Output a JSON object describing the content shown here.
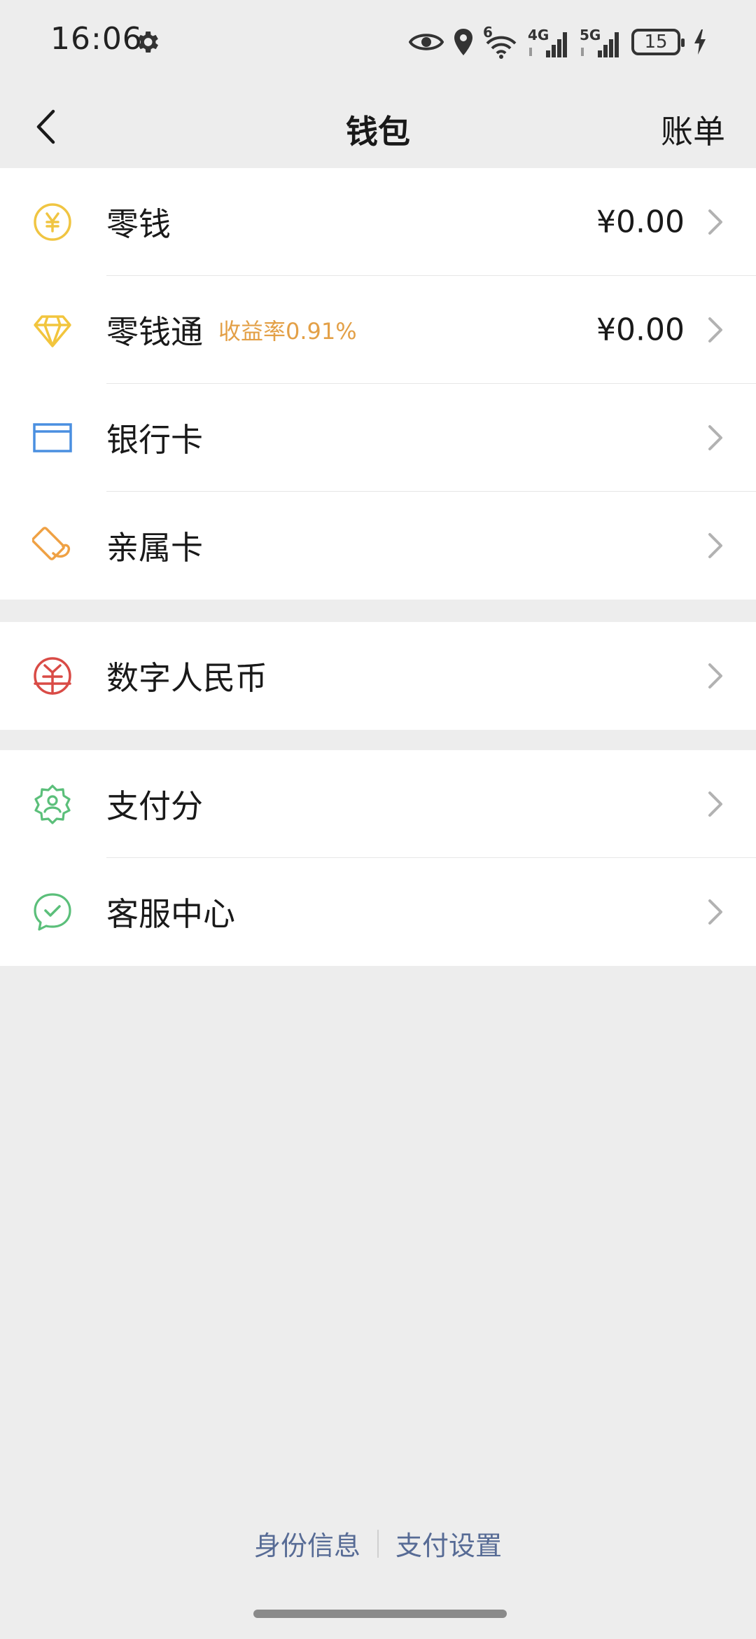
{
  "status_bar": {
    "time": "16:06",
    "gear_icon": "gear-icon",
    "eye_icon": "eye-icon",
    "location_icon": "location-pin-icon",
    "wifi_label": "6",
    "network_1_label": "4G",
    "network_2_label": "5G",
    "battery_level": "15",
    "charging_icon": "lightning-bolt-icon"
  },
  "header": {
    "title": "钱包",
    "back_icon": "chevron-left-icon",
    "bill_label": "账单"
  },
  "groups": [
    {
      "items": [
        {
          "label": "零钱",
          "value": "¥0.00",
          "icon": "yuan-coin-icon",
          "icon_color": "#f0c542"
        },
        {
          "label": "零钱通",
          "badge": "收益率0.91%",
          "value": "¥0.00",
          "icon": "diamond-icon",
          "icon_color": "#f2c53d"
        },
        {
          "label": "银行卡",
          "icon": "bank-card-icon",
          "icon_color": "#4a8fe0"
        },
        {
          "label": "亲属卡",
          "icon": "family-card-icon",
          "icon_color": "#efa144"
        }
      ]
    },
    {
      "items": [
        {
          "label": "数字人民币",
          "icon": "digital-rmb-icon",
          "icon_color": "#d94b46"
        }
      ]
    },
    {
      "items": [
        {
          "label": "支付分",
          "icon": "pay-score-badge-icon",
          "icon_color": "#5bbf7a"
        },
        {
          "label": "客服中心",
          "icon": "customer-service-icon",
          "icon_color": "#5bbf7a"
        }
      ]
    }
  ],
  "footer": {
    "identity_label": "身份信息",
    "payment_settings_label": "支付设置"
  },
  "colors": {
    "background": "#ededed",
    "row_background": "#ffffff",
    "link": "#576b95",
    "badge": "#e3a047"
  }
}
